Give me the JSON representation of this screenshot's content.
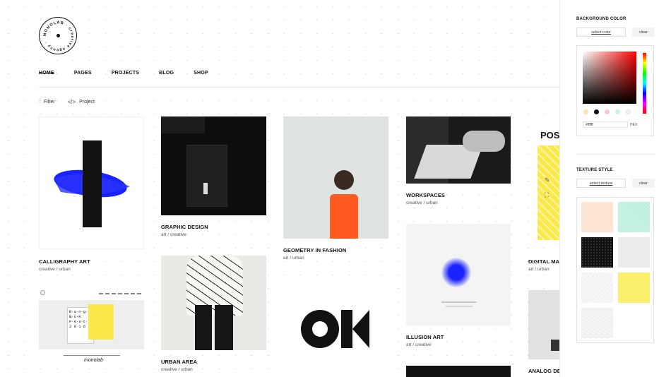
{
  "logo": {
    "ring_text": "MONOLAB · creative agency · ",
    "alt": "monolab logo"
  },
  "nav": [
    "HOME",
    "PAGES",
    "PROJECTS",
    "BLOG",
    "SHOP"
  ],
  "filters": {
    "filter_label": "Filter",
    "project_label": "Project",
    "filter_icon": "sliders-icon",
    "project_icon": "code-icon"
  },
  "cards": {
    "c1": {
      "title": "CALLIGRAPHY ART",
      "sub": "creative / urban"
    },
    "c2": {
      "title": "GRAPHIC DESIGN",
      "sub": "art / creative"
    },
    "c3": {
      "title": "GEOMETRY IN FASHION",
      "sub": "art / urban"
    },
    "c4": {
      "title": "WORKSPACES",
      "sub": "creative / urban"
    },
    "c5": {
      "title": "DIGITAL MAGA",
      "sub": "art / urban",
      "poster_text": "POS"
    },
    "c6": {
      "title": "URBAN AREA",
      "sub": "creative / urban"
    },
    "c7": {
      "title": "ILLUSION ART",
      "sub": "art / creative"
    },
    "c8": {
      "title": "ANALOG DEVI",
      "sub": ""
    },
    "ok": {
      "text": "OK"
    },
    "poster": {
      "text": "B·a·n·g·k·k B·o·K F·e·s·t·i·v·a·l 2 0 1 6"
    },
    "book": {
      "text": "monolab"
    }
  },
  "panel": {
    "bg_title": "BACKGROUND COLOR",
    "select_color": "select color",
    "clear": "clear",
    "hex_value": "#ffffff",
    "hex_label": "HEX",
    "swatches": [
      "#f6e7a8",
      "#111111",
      "#f7c9cf",
      "#c9f1e6",
      "#f2f2f2"
    ],
    "texture_title": "TEXTURE STYLE",
    "select_texture": "select texture",
    "textures": [
      "#fde4d3",
      "#c9f3e4",
      "#111111",
      "#ececec",
      "#f4f4f4",
      "#fbf06e",
      "#f2f2f2"
    ]
  },
  "side_icons": [
    "pencil-icon",
    "expand-icon"
  ],
  "colors": {
    "accent_blue": "#1a22ff",
    "orange": "#ff5a1f",
    "yellow": "#fbe94a"
  }
}
